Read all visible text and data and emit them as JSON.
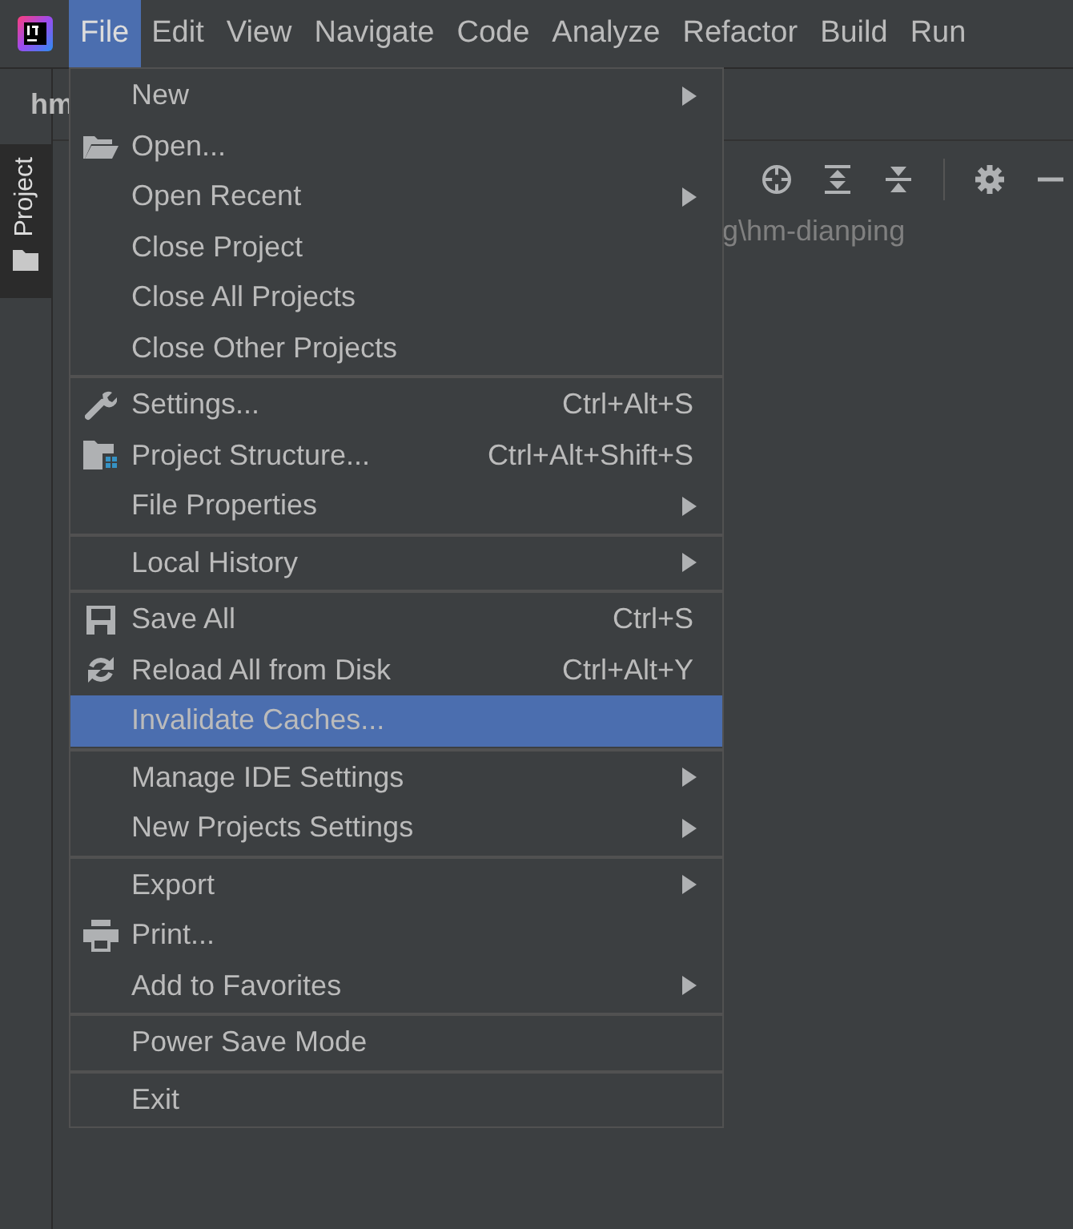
{
  "menubar": [
    {
      "label": "File",
      "selected": true
    },
    {
      "label": "Edit",
      "selected": false
    },
    {
      "label": "View",
      "selected": false
    },
    {
      "label": "Navigate",
      "selected": false
    },
    {
      "label": "Code",
      "selected": false
    },
    {
      "label": "Analyze",
      "selected": false
    },
    {
      "label": "Refactor",
      "selected": false
    },
    {
      "label": "Build",
      "selected": false
    },
    {
      "label": "Run",
      "selected": false
    }
  ],
  "project_tab": "hm",
  "tool_window": {
    "label": "Project"
  },
  "path": "g\\hm-dianping",
  "menu": {
    "groups": [
      [
        {
          "label": "New",
          "submenu": true,
          "selected": false
        },
        {
          "label": "Open...",
          "kind": "folder",
          "submenu": false,
          "selected": false
        },
        {
          "label": "Open Recent",
          "submenu": true,
          "selected": false
        },
        {
          "label": "Close Project",
          "submenu": false,
          "selected": false
        },
        {
          "label": "Close All Projects",
          "submenu": false,
          "selected": false
        },
        {
          "label": "Close Other Projects",
          "submenu": false,
          "selected": false
        }
      ],
      [
        {
          "label": "Settings...",
          "kind": "wrench",
          "shortcut": "Ctrl+Alt+S",
          "submenu": false,
          "selected": false
        },
        {
          "label": "Project Structure...",
          "kind": "structure",
          "shortcut": "Ctrl+Alt+Shift+S",
          "submenu": false,
          "selected": false
        },
        {
          "label": "File Properties",
          "submenu": true,
          "selected": false
        }
      ],
      [
        {
          "label": "Local History",
          "submenu": true,
          "selected": false
        }
      ],
      [
        {
          "label": "Save All",
          "kind": "save",
          "shortcut": "Ctrl+S",
          "submenu": false,
          "selected": false
        },
        {
          "label": "Reload All from Disk",
          "kind": "reload",
          "shortcut": "Ctrl+Alt+Y",
          "submenu": false,
          "selected": false
        },
        {
          "label": "Invalidate Caches...",
          "submenu": false,
          "selected": true
        }
      ],
      [
        {
          "label": "Manage IDE Settings",
          "submenu": true,
          "selected": false
        },
        {
          "label": "New Projects Settings",
          "submenu": true,
          "selected": false
        }
      ],
      [
        {
          "label": "Export",
          "submenu": true,
          "selected": false
        },
        {
          "label": "Print...",
          "kind": "printer",
          "submenu": false,
          "selected": false
        },
        {
          "label": "Add to Favorites",
          "submenu": true,
          "selected": false
        }
      ],
      [
        {
          "label": "Power Save Mode",
          "submenu": false,
          "selected": false
        }
      ],
      [
        {
          "label": "Exit",
          "submenu": false,
          "selected": false
        }
      ]
    ]
  }
}
